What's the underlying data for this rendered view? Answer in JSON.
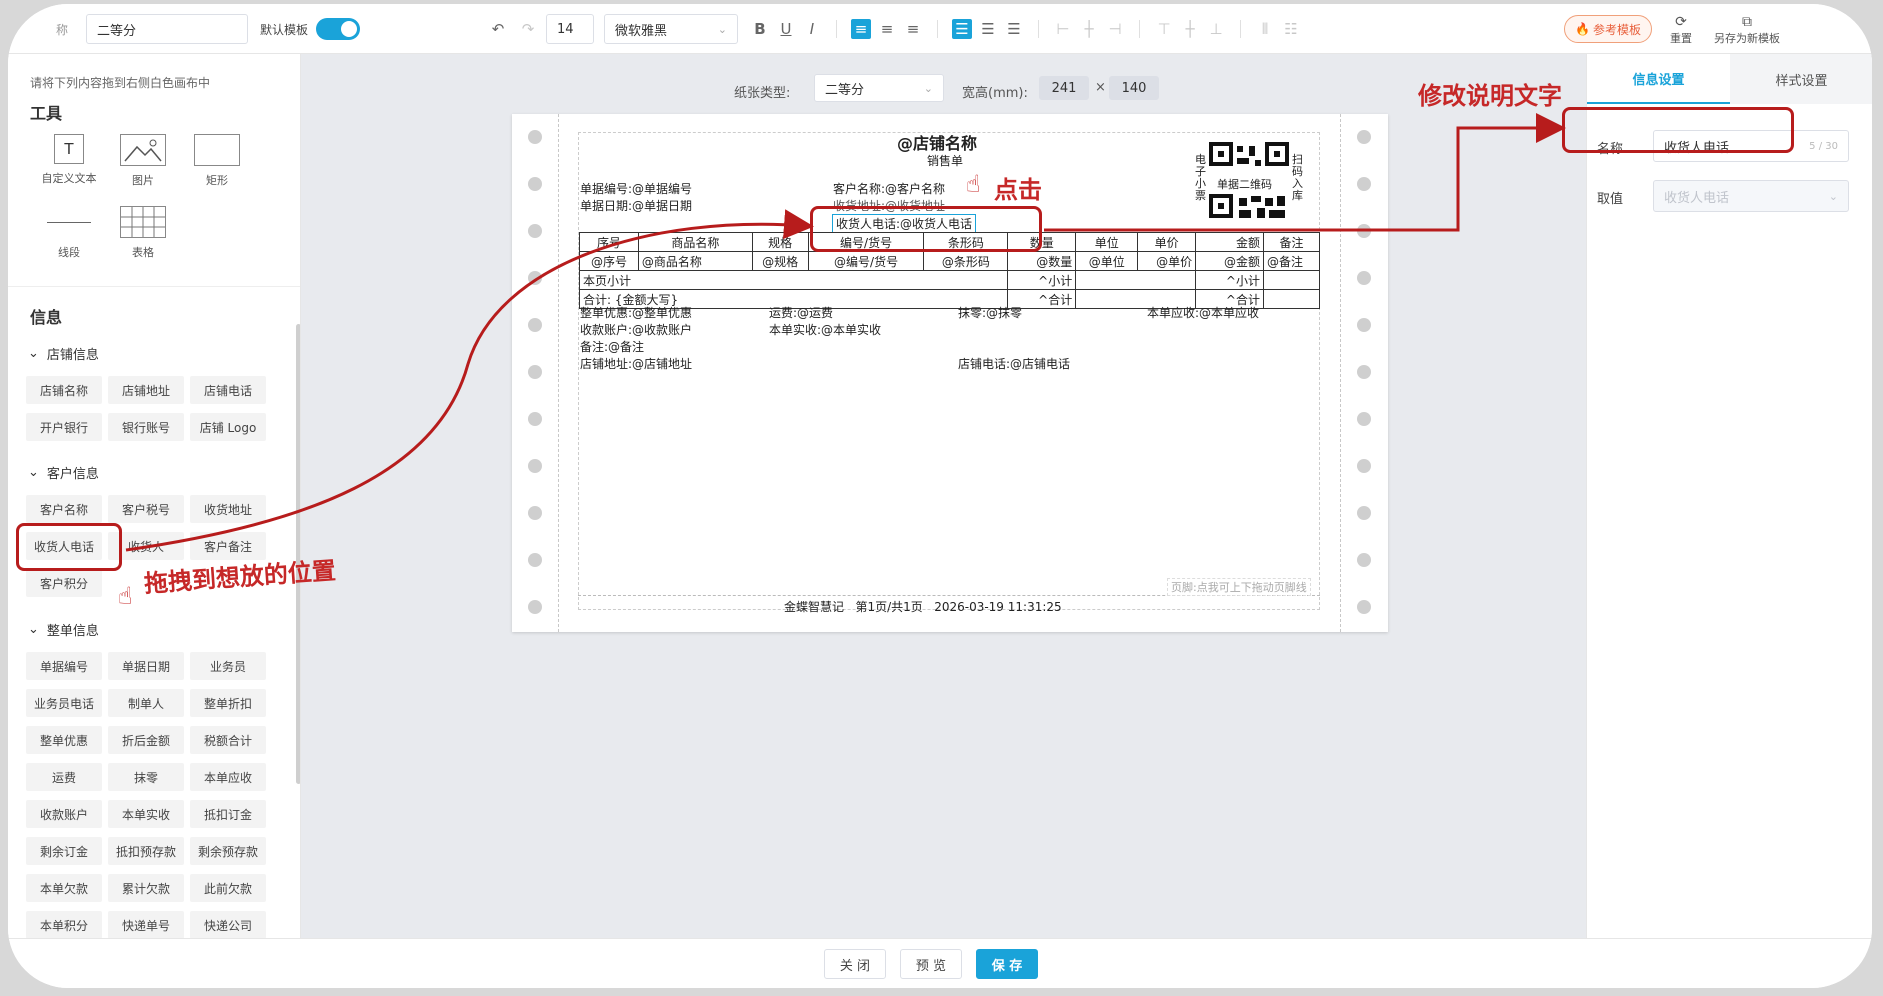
{
  "toolbar": {
    "template_name_prefix": "称",
    "template_name": "二等分",
    "default_template_label": "默认模板",
    "font_size": "14",
    "font_family": "微软雅黑",
    "bold": "B",
    "underline": "U",
    "italic": "I",
    "reference_template": "参考模板",
    "reset": "重置",
    "save_as_new": "另存为新模板"
  },
  "left_panel": {
    "hint": "请将下列内容拖到右侧白色画布中",
    "tools_title": "工具",
    "tools": [
      "自定义文本",
      "图片",
      "矩形",
      "线段",
      "表格"
    ],
    "tool_text_glyph": "T",
    "info_title": "信息",
    "groups": [
      {
        "name": "店铺信息",
        "items": [
          "店铺名称",
          "店铺地址",
          "店铺电话",
          "开户银行",
          "银行账号",
          "店铺 Logo"
        ]
      },
      {
        "name": "客户信息",
        "items": [
          "客户名称",
          "客户税号",
          "收货地址",
          "收货人电话",
          "收货人",
          "客户备注",
          "客户积分"
        ]
      },
      {
        "name": "整单信息",
        "items": [
          "单据编号",
          "单据日期",
          "业务员",
          "业务员电话",
          "制单人",
          "整单折扣",
          "整单优惠",
          "折后金额",
          "税额合计",
          "运费",
          "抹零",
          "本单应收",
          "收款账户",
          "本单实收",
          "抵扣订金",
          "剩余订金",
          "抵扣预存款",
          "剩余预存款",
          "本单欠款",
          "累计欠款",
          "此前欠款",
          "本单积分",
          "快递单号",
          "快递公司"
        ]
      }
    ]
  },
  "canvas": {
    "paper_type_label": "纸张类型:",
    "paper_type": "二等分",
    "size_label": "宽高(mm):",
    "width": "241",
    "times": "×",
    "height": "140"
  },
  "receipt": {
    "store_name": "@店铺名称",
    "doc_type": "销售单",
    "qr_left_text": "电子小票",
    "qr_caption": "单据二维码",
    "qr_right_text": "扫码入库",
    "doc_no": "单据编号:@单据编号",
    "doc_date": "单据日期:@单据日期",
    "customer_name": "客户名称:@客户名称",
    "ship_address": "收货地址:@收货地址",
    "receiver_phone": "收货人电话:@收货人电话",
    "table_headers": [
      "序号",
      "商品名称",
      "规格",
      "编号/货号",
      "条形码",
      "数量",
      "单位",
      "单价",
      "金额",
      "备注"
    ],
    "table_row": [
      "@序号",
      "@商品名称",
      "@规格",
      "@编号/货号",
      "@条形码",
      "@数量",
      "@单位",
      "@单价",
      "@金额",
      "@备注"
    ],
    "subtotal_label": "本页小计",
    "subtotal_qty": "^小计",
    "subtotal_amount": "^小计",
    "total_label": "合计: {金额大写}",
    "total_qty": "^合计",
    "total_amount": "^合计",
    "discount": "整单优惠:@整单优惠",
    "freight": "运费:@运费",
    "rounding": "抹零:@抹零",
    "receivable": "本单应收:@本单应收",
    "account": "收款账户:@收款账户",
    "received": "本单实收:@本单实收",
    "remark": "备注:@备注",
    "store_address": "店铺地址:@店铺地址",
    "store_phone": "店铺电话:@店铺电话",
    "footer_hint": "页脚:点我可上下拖动页脚线",
    "footer": "金蝶智慧记   第1页/共1页   2026-03-19 11:31:25"
  },
  "right_panel": {
    "tab_info": "信息设置",
    "tab_style": "样式设置",
    "name_label": "名称",
    "name_value": "收货人电话",
    "name_count": "5 / 30",
    "value_label": "取值",
    "value_placeholder": "收货人电话"
  },
  "bottom": {
    "close": "关 闭",
    "preview": "预 览",
    "save": "保 存"
  },
  "annotations": {
    "modify_text": "修改说明文字",
    "click_text": "点击",
    "drag_text": "拖拽到想放的位置"
  },
  "colors": {
    "accent": "#1aa3d9",
    "annotation": "#b71c1c"
  }
}
